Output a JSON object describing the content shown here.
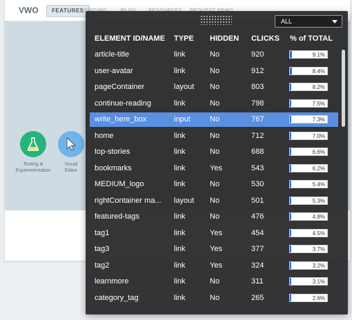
{
  "background": {
    "logo_text": "VWO",
    "nav_active": "FEATURES",
    "nav_items": [
      "PRICING",
      "BLOG",
      "RESOURCES",
      "REQUEST DEMO"
    ],
    "features": [
      {
        "label_line1": "Testing &",
        "label_line2": "Experimentation",
        "icon": "flask-icon"
      },
      {
        "label_line1": "Visual",
        "label_line2": "Editor",
        "icon": "cursor-icon"
      }
    ]
  },
  "panel": {
    "filter": {
      "value": "ALL",
      "options": [
        "ALL"
      ]
    },
    "headers": {
      "id": "ELEMENT ID/NAME",
      "type": "TYPE",
      "hidden": "HIDDEN",
      "clicks": "CLICKS",
      "percent": "% of TOTAL"
    },
    "rows": [
      {
        "id": "article-title",
        "type": "link",
        "hidden": "No",
        "clicks": "920",
        "percent": "9.1%",
        "value": 9.1
      },
      {
        "id": "user-avatar",
        "type": "link",
        "hidden": "No",
        "clicks": "912",
        "percent": "8.4%",
        "value": 8.4
      },
      {
        "id": "pageContainer",
        "type": "layout",
        "hidden": "No",
        "clicks": "803",
        "percent": "8.2%",
        "value": 8.2
      },
      {
        "id": "continue-reading",
        "type": "link",
        "hidden": "No",
        "clicks": "798",
        "percent": "7.5%",
        "value": 7.5
      },
      {
        "id": "write_here_box",
        "type": "input",
        "hidden": "No",
        "clicks": "767",
        "percent": "7.3%",
        "value": 7.3
      },
      {
        "id": "home",
        "type": "link",
        "hidden": "No",
        "clicks": "712",
        "percent": "7.0%",
        "value": 7.0
      },
      {
        "id": "top-stories",
        "type": "link",
        "hidden": "No",
        "clicks": "688",
        "percent": "6.6%",
        "value": 6.6
      },
      {
        "id": "bookmarks",
        "type": "link",
        "hidden": "Yes",
        "clicks": "543",
        "percent": "6.2%",
        "value": 6.2
      },
      {
        "id": "MEDIUM_logo",
        "type": "link",
        "hidden": "No",
        "clicks": "530",
        "percent": "5.4%",
        "value": 5.4
      },
      {
        "id": "rightContainer ma...",
        "type": "layout",
        "hidden": "No",
        "clicks": "501",
        "percent": "5.3%",
        "value": 5.3
      },
      {
        "id": "featured-tags",
        "type": "link",
        "hidden": "No",
        "clicks": "476",
        "percent": "4.8%",
        "value": 4.8
      },
      {
        "id": "tag1",
        "type": "link",
        "hidden": "Yes",
        "clicks": "454",
        "percent": "4.5%",
        "value": 4.5
      },
      {
        "id": "tag3",
        "type": "link",
        "hidden": "Yes",
        "clicks": "377",
        "percent": "3.7%",
        "value": 3.7
      },
      {
        "id": "tag2",
        "type": "link",
        "hidden": "Yes",
        "clicks": "324",
        "percent": "3.2%",
        "value": 3.2
      },
      {
        "id": "learnmore",
        "type": "link",
        "hidden": "No",
        "clicks": "311",
        "percent": "3.1%",
        "value": 3.1
      },
      {
        "id": "category_tag",
        "type": "link",
        "hidden": "No",
        "clicks": "265",
        "percent": "2.6%",
        "value": 2.6
      }
    ],
    "selected_row_index": 4,
    "colors": {
      "panel_bg": "#262628",
      "selected": "#5a8fe2",
      "bar_fill": "#2f6fd6"
    }
  }
}
